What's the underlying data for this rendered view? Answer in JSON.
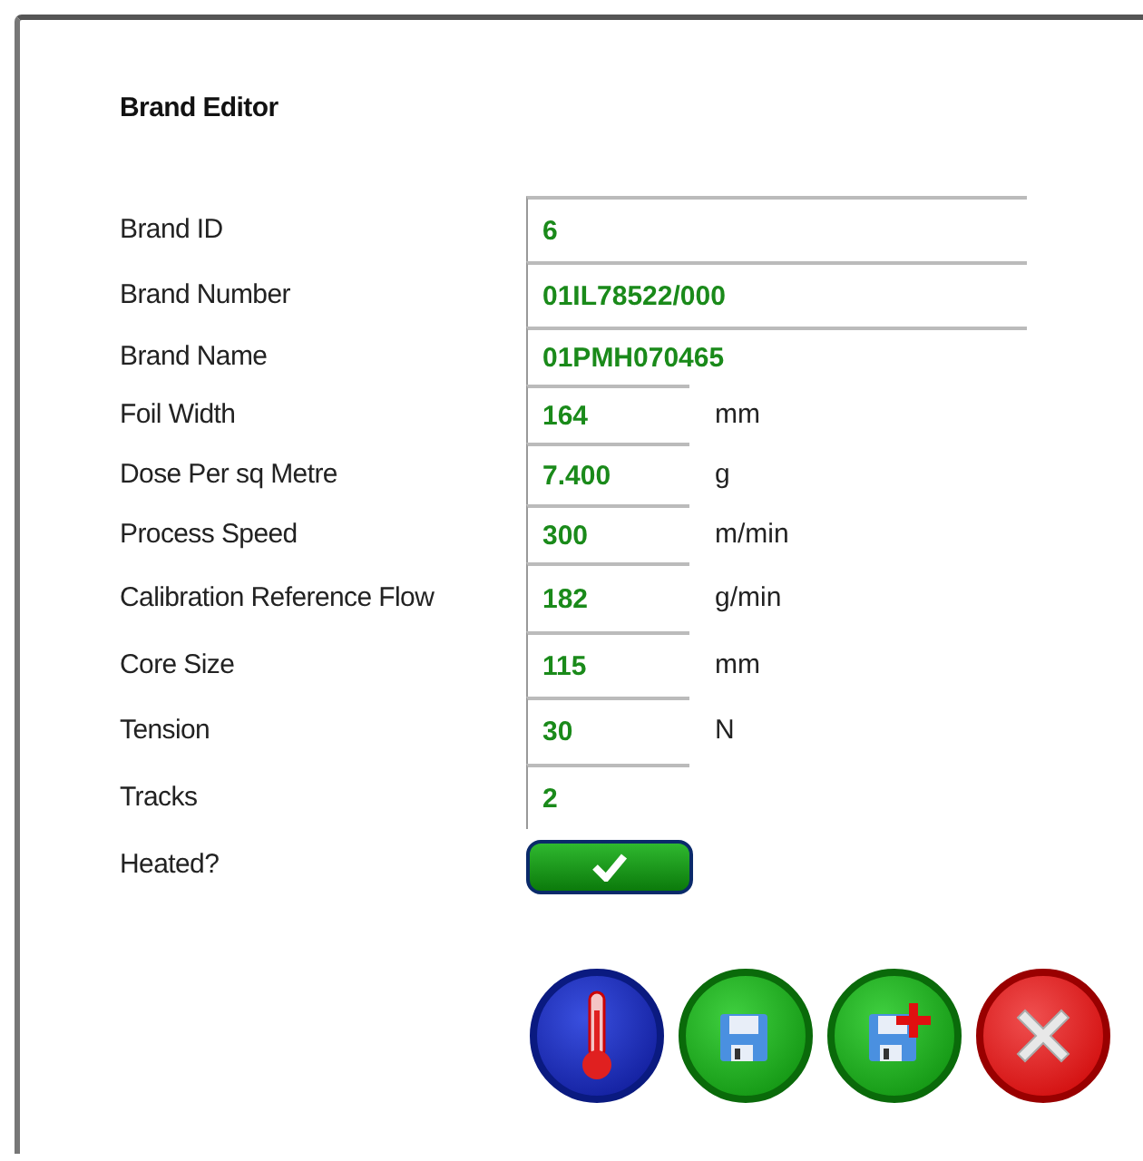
{
  "window": {
    "title": "Brand Editor"
  },
  "fields": [
    {
      "label": "Brand ID",
      "value": "6",
      "kind": "wide"
    },
    {
      "label": "Brand Number",
      "value": "01IL78522/000",
      "kind": "wide"
    },
    {
      "label": "Brand Name",
      "value": "01PMH070465",
      "kind": "wide"
    },
    {
      "label": "Foil Width",
      "value": "164",
      "unit": "mm",
      "kind": "narrow"
    },
    {
      "label": "Dose Per sq Metre",
      "value": "7.400",
      "unit": "g",
      "kind": "narrow"
    },
    {
      "label": "Process Speed",
      "value": "300",
      "unit": "m/min",
      "kind": "narrow"
    },
    {
      "label": "Calibration Reference Flow",
      "value": "182",
      "unit": "g/min",
      "kind": "narrow"
    },
    {
      "label": "Core Size",
      "value": "115",
      "unit": "mm",
      "kind": "narrow"
    },
    {
      "label": "Tension",
      "value": "30",
      "unit": "N",
      "kind": "narrow"
    },
    {
      "label": "Tracks",
      "value": "2",
      "kind": "narrow"
    }
  ],
  "heated": {
    "label": "Heated?",
    "checked": true
  },
  "actions": [
    {
      "kind": "heat"
    },
    {
      "kind": "save"
    },
    {
      "kind": "save-new"
    },
    {
      "kind": "cancel"
    }
  ]
}
